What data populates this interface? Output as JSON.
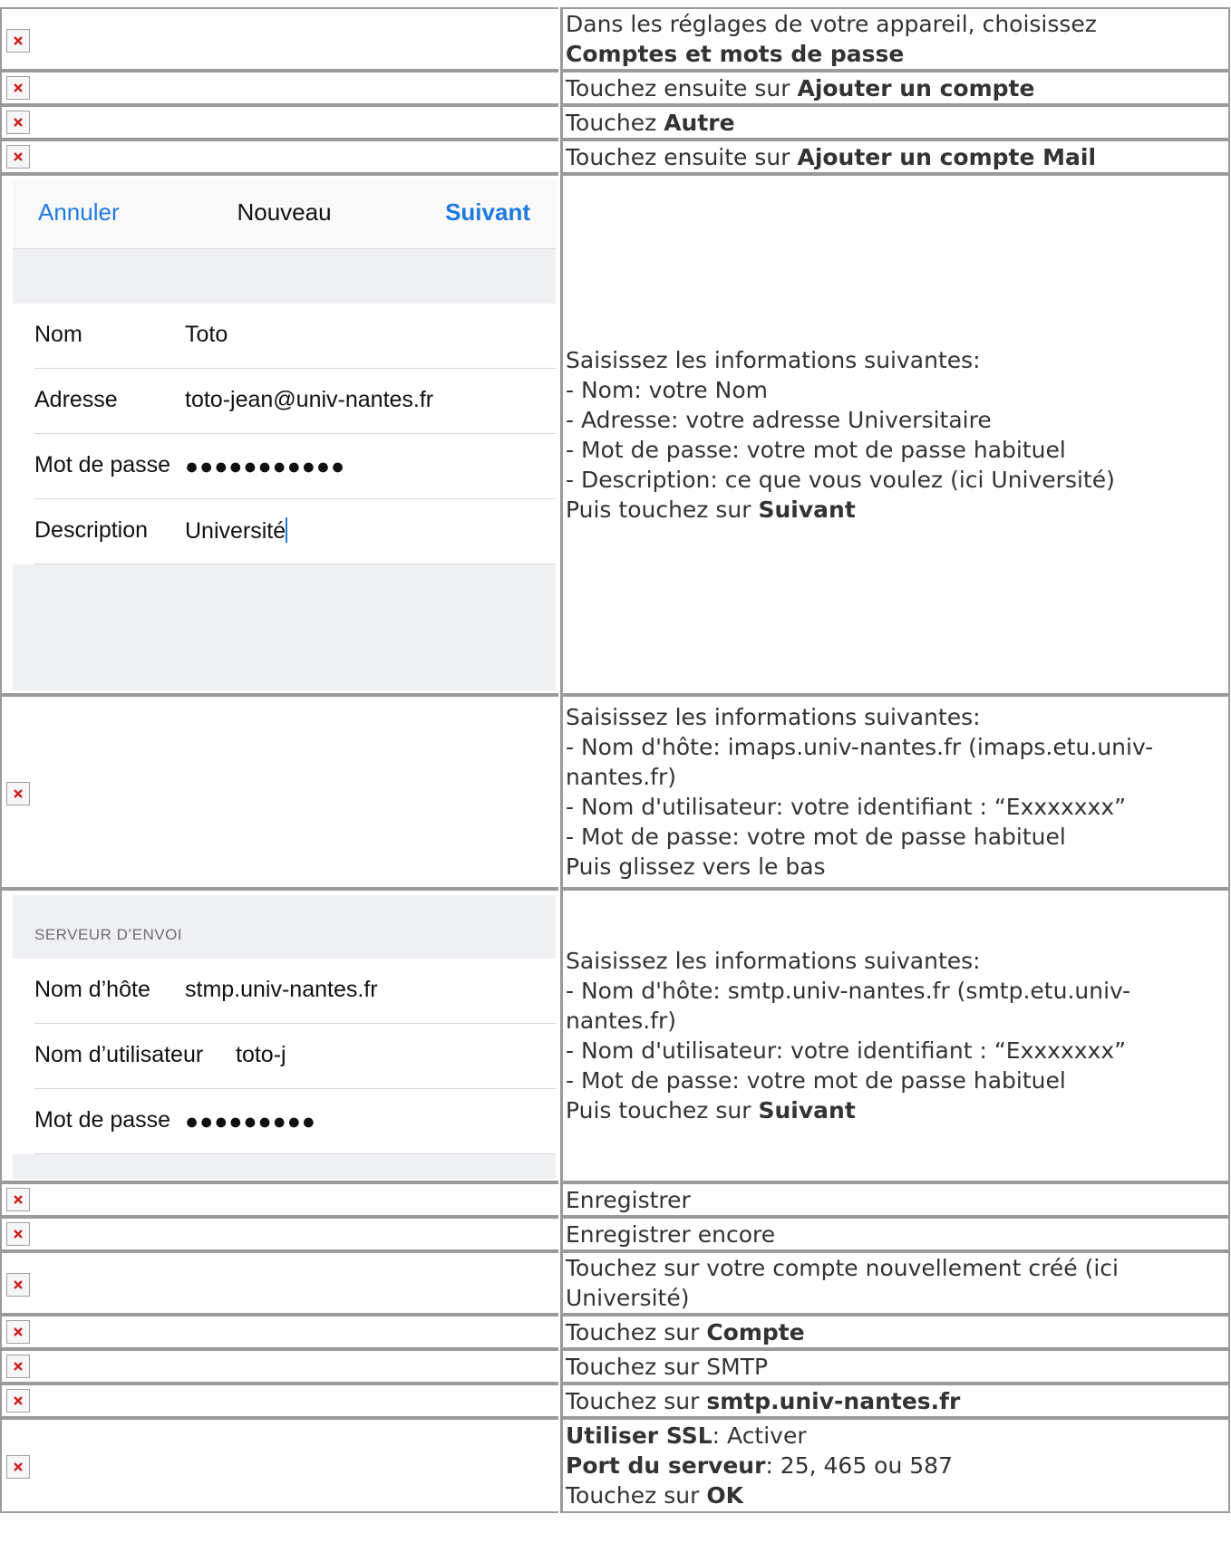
{
  "rows": [
    {
      "text_a": "Dans les réglages de votre appareil, choisissez",
      "bold_b": "Comptes et mots de passe"
    },
    {
      "text_a": "Touchez ensuite sur ",
      "bold_a": "Ajouter un compte"
    },
    {
      "text_a": "Touchez ",
      "bold_a": "Autre"
    },
    {
      "text_a": "Touchez ensuite sur ",
      "bold_a": "Ajouter un compte Mail"
    },
    {
      "lines": [
        "Saisissez les informations suivantes:",
        "- Nom: votre Nom",
        "- Adresse: votre adresse Universitaire",
        "- Mot de passe: votre mot de passe habituel",
        "- Description: ce que vous voulez (ici Université)"
      ],
      "last_text": "Puis touchez sur ",
      "last_bold": "Suivant"
    },
    {
      "lines": [
        "Saisissez les informations suivantes:",
        "- Nom d'hôte: imaps.univ-nantes.fr (imaps.etu.univ-nantes.fr)",
        "- Nom d'utilisateur: votre identifiant : “Exxxxxxx”",
        "- Mot de passe: votre mot de passe habituel",
        "Puis glissez vers le bas"
      ]
    },
    {
      "lines": [
        "Saisissez les informations suivantes:",
        "- Nom d'hôte: smtp.univ-nantes.fr (smtp.etu.univ-nantes.fr)",
        "- Nom d'utilisateur: votre identifiant : “Exxxxxxx”",
        "- Mot de passe: votre mot de passe habituel"
      ],
      "last_text": "Puis touchez sur ",
      "last_bold": "Suivant"
    },
    {
      "text_a": "Enregistrer"
    },
    {
      "text_a": "Enregistrer encore"
    },
    {
      "text_a": "Touchez sur votre compte nouvellement créé (ici Université)"
    },
    {
      "text_a": "Touchez sur ",
      "bold_a": "Compte"
    },
    {
      "text_a": "Touchez sur SMTP"
    },
    {
      "text_a": "Touchez sur ",
      "bold_a": "smtp.univ-nantes.fr"
    },
    {
      "b1": "Utiliser SSL",
      "t1": ": Activer",
      "b2": "Port du serveur",
      "t2": ": 25, 465 ou 587",
      "t3": "Touchez sur ",
      "b3": "OK"
    }
  ],
  "phone1": {
    "cancel": "Annuler",
    "title": "Nouveau",
    "next": "Suivant",
    "fields": [
      {
        "label": "Nom",
        "value": "Toto"
      },
      {
        "label": "Adresse",
        "value": "toto-jean@univ-nantes.fr"
      },
      {
        "label": "Mot de passe",
        "value": "●●●●●●●●●●●"
      },
      {
        "label": "Description",
        "value": "Université"
      }
    ]
  },
  "phone2": {
    "section": "SERVEUR D’ENVOI",
    "fields": [
      {
        "label": "Nom d’hôte",
        "value": "stmp.univ-nantes.fr"
      },
      {
        "label": "Nom d’utilisateur",
        "value": "toto-j"
      },
      {
        "label": "Mot de passe",
        "value": "●●●●●●●●●"
      }
    ]
  },
  "broken_icon": "broken-image-icon"
}
